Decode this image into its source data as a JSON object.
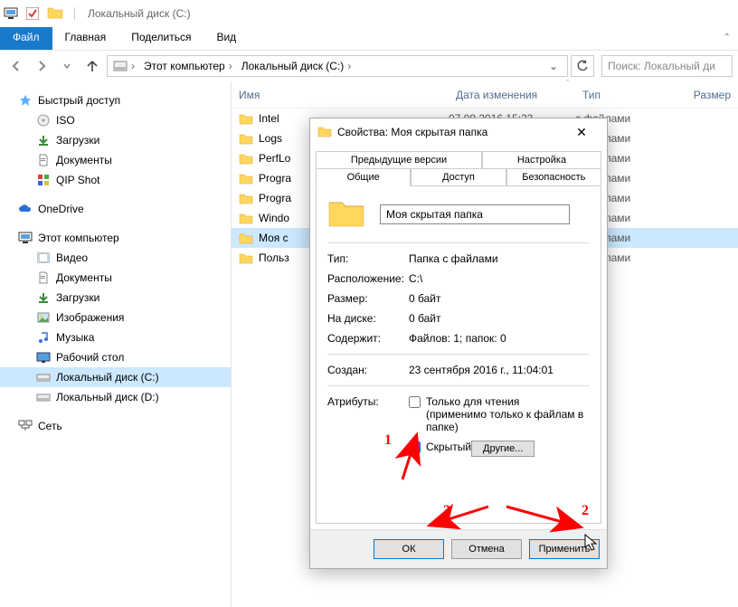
{
  "titlebar": {
    "title": "Локальный диск (C:)"
  },
  "ribbon": {
    "file": "Файл",
    "home": "Главная",
    "share": "Поделиться",
    "view": "Вид"
  },
  "address": {
    "root": "Этот компьютер",
    "current": "Локальный диск (C:)"
  },
  "search": {
    "placeholder": "Поиск: Локальный ди"
  },
  "columns": {
    "name": "Имя",
    "date": "Дата изменения",
    "type": "Тип",
    "size": "Размер"
  },
  "sidebar": {
    "quick": "Быстрый доступ",
    "items_quick": [
      "ISO",
      "Загрузки",
      "Документы",
      "QIP Shot"
    ],
    "onedrive": "OneDrive",
    "thispc": "Этот компьютер",
    "items_pc": [
      "Видео",
      "Документы",
      "Загрузки",
      "Изображения",
      "Музыка",
      "Рабочий стол",
      "Локальный диск (C:)",
      "Локальный диск (D:)"
    ],
    "network": "Сеть"
  },
  "files": [
    {
      "name": "Intel",
      "date": "07.09.2016 15:33",
      "type": "с файлами"
    },
    {
      "name": "Logs",
      "date": "",
      "type": "с файлами"
    },
    {
      "name": "PerfLo",
      "date": "",
      "type": "с файлами"
    },
    {
      "name": "Progra",
      "date": "",
      "type": "с файлами"
    },
    {
      "name": "Progra",
      "date": "",
      "type": "с файлами"
    },
    {
      "name": "Windo",
      "date": "",
      "type": "с файлами"
    },
    {
      "name": "Моя с",
      "date": "",
      "type": "с файлами"
    },
    {
      "name": "Польз",
      "date": "",
      "type": "с файлами"
    }
  ],
  "selected_file_index": 6,
  "dialog": {
    "title": "Свойства: Моя скрытая папка",
    "tabs_row1": [
      "Предыдущие версии",
      "Настройка"
    ],
    "tabs_row2": [
      "Общие",
      "Доступ",
      "Безопасность"
    ],
    "active_tab": "Общие",
    "folder_name": "Моя скрытая папка",
    "props": {
      "type_l": "Тип:",
      "type_v": "Папка с файлами",
      "loc_l": "Расположение:",
      "loc_v": "C:\\",
      "size_l": "Размер:",
      "size_v": "0 байт",
      "disk_l": "На диске:",
      "disk_v": "0 байт",
      "cont_l": "Содержит:",
      "cont_v": "Файлов: 1; папок: 0",
      "created_l": "Создан:",
      "created_v": "23 сентября 2016 г., 11:04:01",
      "attr_l": "Атрибуты:"
    },
    "readonly_l": "Только для чтения",
    "readonly_sub": "(применимо только к файлам в папке)",
    "hidden_l": "Скрытый",
    "other_btn": "Другие...",
    "ok": "ОК",
    "cancel": "Отмена",
    "apply": "Применить"
  },
  "anno": {
    "n1": "1",
    "n2": "2",
    "n3": "3"
  }
}
